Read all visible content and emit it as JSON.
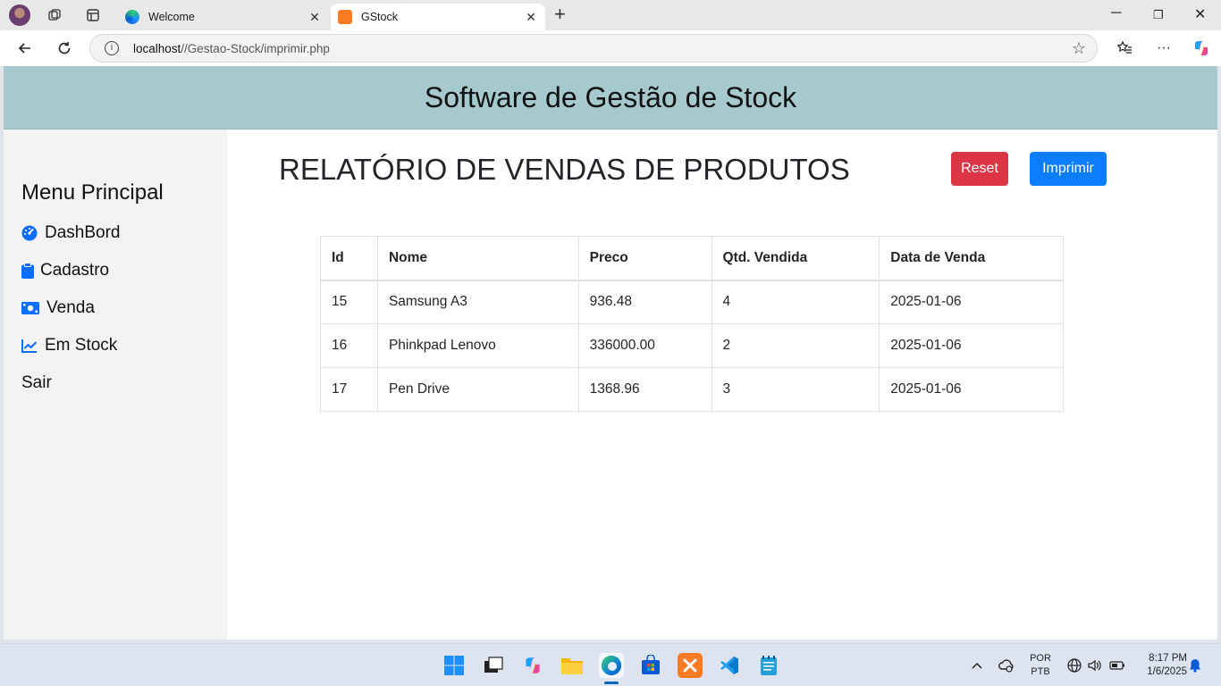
{
  "browser": {
    "tabs": [
      {
        "title": "Welcome",
        "active": false
      },
      {
        "title": "GStock",
        "active": true
      }
    ],
    "url_host": "localhost",
    "url_path": "//Gestao-Stock/imprimir.php"
  },
  "app": {
    "header_title": "Software de Gestão de Stock"
  },
  "sidebar": {
    "title": "Menu Principal",
    "items": [
      {
        "label": "DashBord",
        "icon": "dashboard-gauge-icon"
      },
      {
        "label": "Cadastro",
        "icon": "clipboard-icon"
      },
      {
        "label": "Venda",
        "icon": "money-bill-icon"
      },
      {
        "label": "Em Stock",
        "icon": "line-chart-icon"
      },
      {
        "label": "Sair",
        "icon": ""
      }
    ]
  },
  "report": {
    "title": "RELATÓRIO DE VENDAS DE PRODUTOS",
    "reset_label": "Reset",
    "print_label": "Imprimir",
    "columns": [
      "Id",
      "Nome",
      "Preco",
      "Qtd. Vendida",
      "Data de Venda"
    ],
    "rows": [
      [
        "15",
        "Samsung A3",
        "936.48",
        "4",
        "2025-01-06"
      ],
      [
        "16",
        "Phinkpad Lenovo",
        "336000.00",
        "2",
        "2025-01-06"
      ],
      [
        "17",
        "Pen Drive",
        "1368.96",
        "3",
        "2025-01-06"
      ]
    ]
  },
  "taskbar": {
    "lang_line1": "POR",
    "lang_line2": "PTB",
    "time": "8:17 PM",
    "date": "1/6/2025"
  },
  "colors": {
    "header_bg": "#a6c9ce",
    "sidebar_bg": "#f3f3f3",
    "reset_btn": "#dc3545",
    "print_btn": "#0d7efb",
    "icon_blue": "#0d6efd"
  }
}
